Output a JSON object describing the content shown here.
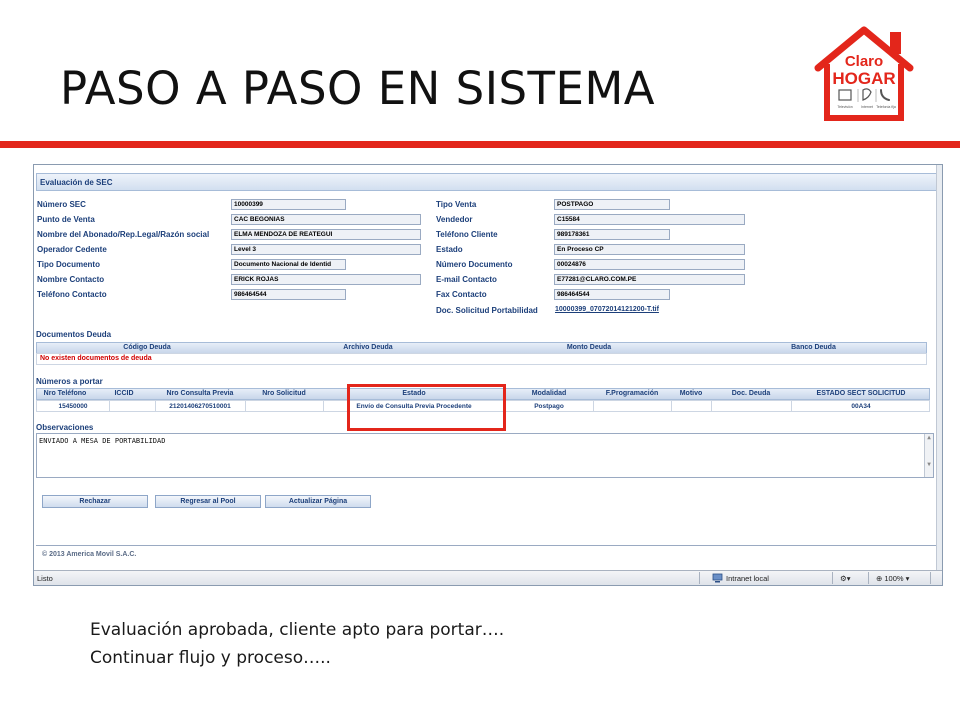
{
  "slide": {
    "title": "PASO A PASO EN SISTEMA",
    "caption_line1": "Evaluación aprobada, cliente apto para portar….",
    "caption_line2": "Continuar flujo y proceso…..",
    "accent_color": "#e3261b"
  },
  "logo": {
    "line1": "Claro",
    "line2": "HOGAR",
    "tiny1": "Televisión",
    "tiny2": "Internet",
    "tiny3": "Telefonía fija",
    "color": "#e3261b"
  },
  "form": {
    "section_title": "Evaluación de SEC",
    "left_fields": [
      {
        "label": "Número SEC",
        "value": "10000399"
      },
      {
        "label": "Punto de Venta",
        "value": "CAC BEGONIAS"
      },
      {
        "label": "Nombre del Abonado/Rep.Legal/Razón social",
        "value": "ELMA MENDOZA DE REATEGUI"
      },
      {
        "label": "Operador Cedente",
        "value": "Level 3"
      },
      {
        "label": "Tipo Documento",
        "value": "Documento Nacional de Identid"
      },
      {
        "label": "Nombre Contacto",
        "value": "ERICK ROJAS"
      },
      {
        "label": "Teléfono Contacto",
        "value": "986464544"
      }
    ],
    "right_fields": [
      {
        "label": "Tipo Venta",
        "value": "POSTPAGO"
      },
      {
        "label": "Vendedor",
        "value": "C15584"
      },
      {
        "label": "Teléfono Cliente",
        "value": "989178361"
      },
      {
        "label": "Estado",
        "value": "En Proceso CP"
      },
      {
        "label": "Número Documento",
        "value": "00024876"
      },
      {
        "label": "E-mail Contacto",
        "value": "E77281@CLARO.COM.PE"
      },
      {
        "label": "Fax Contacto",
        "value": "986464544"
      }
    ],
    "portability_doc_label": "Doc. Solicitud Portabilidad",
    "portability_doc_link": "10000399_07072014121200-T.tif"
  },
  "debts": {
    "title": "Documentos Deuda",
    "columns": [
      "Código Deuda",
      "Archivo Deuda",
      "Monto Deuda",
      "Banco Deuda"
    ],
    "empty_message": "No existen documentos de deuda"
  },
  "numbers": {
    "title": "Números a portar",
    "columns": [
      "Nro Teléfono",
      "ICCID",
      "Nro Consulta Previa",
      "Nro Solicitud",
      "Estado",
      "Modalidad",
      "F.Programación",
      "Motivo",
      "Doc. Deuda",
      "ESTADO SECT SOLICITUD"
    ],
    "row": {
      "telefono": "15450000",
      "iccid": "",
      "consulta": "21201406270510001",
      "solicitud": "",
      "estado": "Envío de Consulta Previa Procedente",
      "modalidad": "Postpago",
      "programacion": "",
      "motivo": "",
      "doc_deuda": "",
      "estado_sect": "00A34"
    }
  },
  "observations": {
    "title": "Observaciones",
    "text": "ENVIADO A MESA DE PORTABILIDAD"
  },
  "buttons": {
    "reject": "Rechazar",
    "back_to_pool": "Regresar al Pool",
    "refresh": "Actualizar Página"
  },
  "footer": {
    "copyright": "© 2013 America Movil S.A.C."
  },
  "statusbar": {
    "status": "Listo",
    "zone": "Intranet local",
    "zoom": "100%"
  }
}
